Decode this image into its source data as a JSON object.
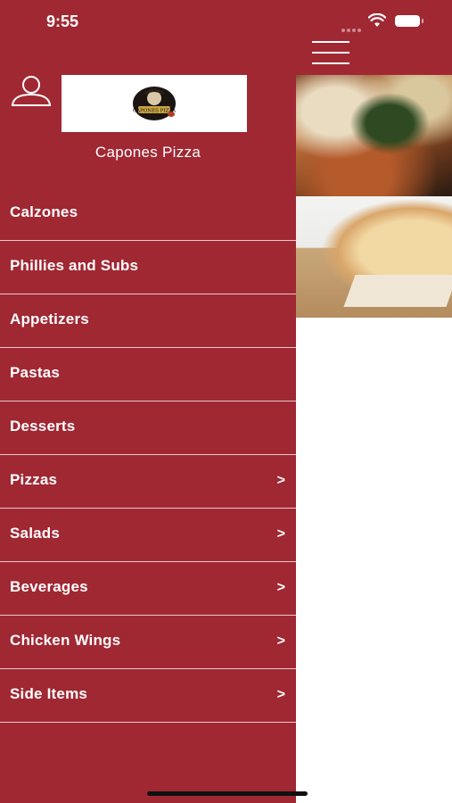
{
  "status_bar": {
    "time": "9:55"
  },
  "header": {
    "store_name": "Capones Pizza",
    "logo_text": "CAPONES PIZZA"
  },
  "menu": {
    "items": [
      {
        "label": "Calzones",
        "arrow": ""
      },
      {
        "label": "Phillies and Subs",
        "arrow": ""
      },
      {
        "label": "Appetizers",
        "arrow": ""
      },
      {
        "label": "Pastas",
        "arrow": ""
      },
      {
        "label": "Desserts",
        "arrow": ""
      },
      {
        "label": "Pizzas",
        "arrow": ">"
      },
      {
        "label": "Salads",
        "arrow": ">"
      },
      {
        "label": "Beverages",
        "arrow": ">"
      },
      {
        "label": "Chicken Wings",
        "arrow": ">"
      },
      {
        "label": "Side Items",
        "arrow": ">"
      }
    ]
  },
  "icons": {
    "user": "user-icon",
    "hamburger": "hamburger-menu-icon",
    "wifi": "wifi-icon",
    "battery": "battery-icon"
  },
  "colors": {
    "brand_red": "#a02833",
    "background_white": "#ffffff"
  }
}
